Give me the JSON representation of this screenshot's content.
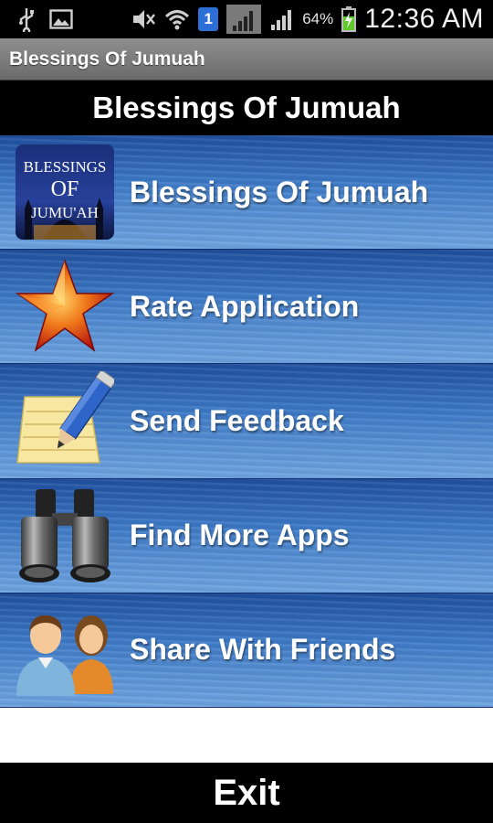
{
  "status_bar": {
    "badge_number": "1",
    "battery_percent": "64%",
    "time": "12:36 AM"
  },
  "title_bar": {
    "title": "Blessings Of Jumuah"
  },
  "header": {
    "title": "Blessings Of Jumuah"
  },
  "menu": {
    "items": [
      {
        "label": "Blessings Of Jumuah",
        "icon": "app-logo-icon",
        "logo_text": [
          "BLESSINGS",
          "OF",
          "JUMU'AH"
        ]
      },
      {
        "label": "Rate Application",
        "icon": "star-icon"
      },
      {
        "label": "Send Feedback",
        "icon": "notepad-pencil-icon"
      },
      {
        "label": "Find More Apps",
        "icon": "binoculars-icon"
      },
      {
        "label": "Share With Friends",
        "icon": "people-icon"
      }
    ]
  },
  "footer": {
    "exit_label": "Exit"
  },
  "colors": {
    "menu_bg_top": "#1f4f9e",
    "menu_bg_bottom": "#6ea3df",
    "badge": "#2d6fd6"
  }
}
